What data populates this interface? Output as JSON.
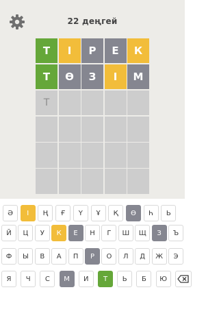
{
  "header": {
    "title": "22 деңгей"
  },
  "board": {
    "rows": [
      [
        {
          "letter": "Т",
          "state": "correct"
        },
        {
          "letter": "І",
          "state": "present"
        },
        {
          "letter": "Р",
          "state": "absent"
        },
        {
          "letter": "Е",
          "state": "absent"
        },
        {
          "letter": "К",
          "state": "present"
        }
      ],
      [
        {
          "letter": "Т",
          "state": "correct"
        },
        {
          "letter": "Ө",
          "state": "absent"
        },
        {
          "letter": "З",
          "state": "absent"
        },
        {
          "letter": "І",
          "state": "present"
        },
        {
          "letter": "М",
          "state": "absent"
        }
      ],
      [
        {
          "letter": "Т",
          "state": "typed"
        },
        {
          "letter": "",
          "state": "empty"
        },
        {
          "letter": "",
          "state": "empty"
        },
        {
          "letter": "",
          "state": "empty"
        },
        {
          "letter": "",
          "state": "empty"
        }
      ],
      [
        {
          "letter": "",
          "state": "empty"
        },
        {
          "letter": "",
          "state": "empty"
        },
        {
          "letter": "",
          "state": "empty"
        },
        {
          "letter": "",
          "state": "empty"
        },
        {
          "letter": "",
          "state": "empty"
        }
      ],
      [
        {
          "letter": "",
          "state": "empty"
        },
        {
          "letter": "",
          "state": "empty"
        },
        {
          "letter": "",
          "state": "empty"
        },
        {
          "letter": "",
          "state": "empty"
        },
        {
          "letter": "",
          "state": "empty"
        }
      ],
      [
        {
          "letter": "",
          "state": "empty"
        },
        {
          "letter": "",
          "state": "empty"
        },
        {
          "letter": "",
          "state": "empty"
        },
        {
          "letter": "",
          "state": "empty"
        },
        {
          "letter": "",
          "state": "empty"
        }
      ]
    ]
  },
  "keyboard": {
    "rows": [
      [
        {
          "letter": "Ә",
          "state": "default"
        },
        {
          "letter": "І",
          "state": "present"
        },
        {
          "letter": "Ң",
          "state": "default"
        },
        {
          "letter": "Ғ",
          "state": "default"
        },
        {
          "letter": "Ү",
          "state": "default"
        },
        {
          "letter": "Ұ",
          "state": "default"
        },
        {
          "letter": "Қ",
          "state": "default"
        },
        {
          "letter": "Ө",
          "state": "absent"
        },
        {
          "letter": "Һ",
          "state": "default"
        },
        {
          "letter": "Ь",
          "state": "default"
        }
      ],
      [
        {
          "letter": "Й",
          "state": "default"
        },
        {
          "letter": "Ц",
          "state": "default"
        },
        {
          "letter": "У",
          "state": "default"
        },
        {
          "letter": "К",
          "state": "present"
        },
        {
          "letter": "Е",
          "state": "absent"
        },
        {
          "letter": "Н",
          "state": "default"
        },
        {
          "letter": "Г",
          "state": "default"
        },
        {
          "letter": "Ш",
          "state": "default"
        },
        {
          "letter": "Щ",
          "state": "default"
        },
        {
          "letter": "З",
          "state": "absent"
        },
        {
          "letter": "Ъ",
          "state": "default"
        }
      ],
      [
        {
          "letter": "Ф",
          "state": "default"
        },
        {
          "letter": "Ы",
          "state": "default"
        },
        {
          "letter": "В",
          "state": "default"
        },
        {
          "letter": "А",
          "state": "default"
        },
        {
          "letter": "П",
          "state": "default"
        },
        {
          "letter": "Р",
          "state": "absent"
        },
        {
          "letter": "О",
          "state": "default"
        },
        {
          "letter": "Л",
          "state": "default"
        },
        {
          "letter": "Д",
          "state": "default"
        },
        {
          "letter": "Ж",
          "state": "default"
        },
        {
          "letter": "Э",
          "state": "default"
        }
      ],
      [
        {
          "letter": "Я",
          "state": "default"
        },
        {
          "letter": "Ч",
          "state": "default"
        },
        {
          "letter": "С",
          "state": "default"
        },
        {
          "letter": "М",
          "state": "absent"
        },
        {
          "letter": "И",
          "state": "default"
        },
        {
          "letter": "Т",
          "state": "correct"
        },
        {
          "letter": "Ь",
          "state": "default"
        },
        {
          "letter": "Б",
          "state": "default"
        },
        {
          "letter": "Ю",
          "state": "default"
        }
      ]
    ],
    "backspace_icon": "backspace-icon"
  },
  "icons": {
    "settings": "gear-icon"
  },
  "colors": {
    "correct": "#65a739",
    "present": "#f2bd3a",
    "absent": "#858690",
    "empty": "#cdcdcd",
    "background": "#edece8"
  }
}
